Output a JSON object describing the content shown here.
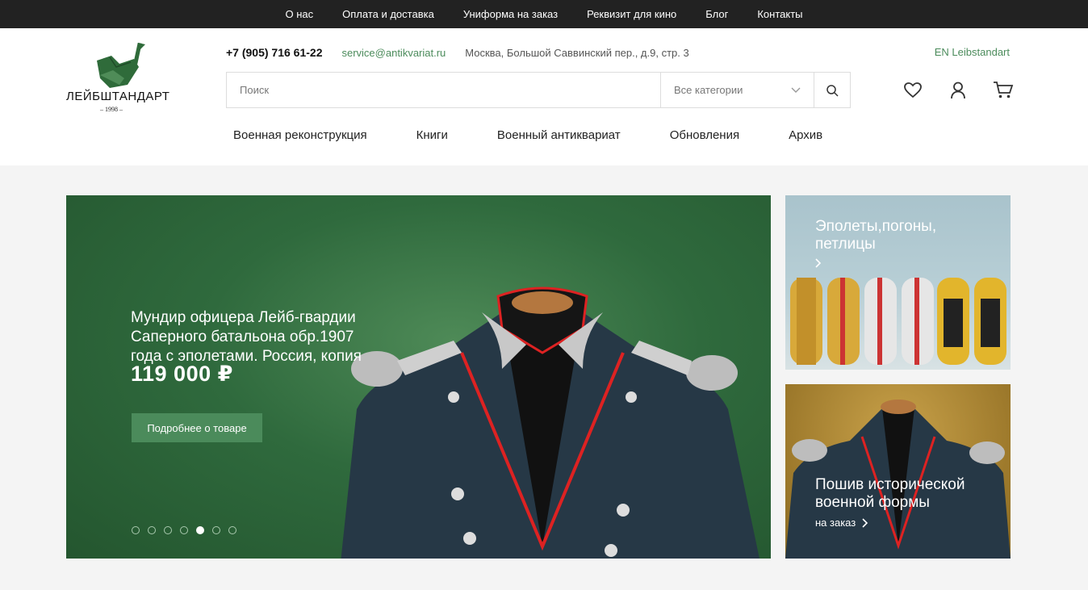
{
  "topnav": [
    "О нас",
    "Оплата и доставка",
    "Униформа на заказ",
    "Реквизит для кино",
    "Блог",
    "Контакты"
  ],
  "logo": {
    "name": "ЛЕЙБШТАНДАРТ",
    "year": "1998"
  },
  "contacts": {
    "phone": "+7 (905) 716 61-22",
    "email": "service@antikvariat.ru",
    "address": "Москва, Большой Саввинский пер., д.9, стр. 3"
  },
  "lang": "EN Leibstandart",
  "search": {
    "placeholder": "Поиск",
    "category": "Все категории"
  },
  "header_icons": [
    "heart-icon",
    "user-icon",
    "cart-icon"
  ],
  "mainnav": [
    "Военная реконструкция",
    "Книги",
    "Военный антиквариат",
    "Обновления",
    "Архив"
  ],
  "hero": {
    "title": "Мундир офицера Лейб-гвардии Саперного батальона обр.1907 года с эполетами. Россия, копия",
    "price": "119 000 ₽",
    "button": "Подробнее о товаре",
    "slides_total": 7,
    "active_slide": 5
  },
  "banners": [
    {
      "title": "Эполеты,погоны, петлицы",
      "subtitle": ""
    },
    {
      "title": "Пошив исторической военной формы",
      "subtitle": "на заказ"
    }
  ],
  "colors": {
    "accent": "#4b8b5b",
    "topbar": "#222222",
    "hero_bg": "#2f6a3d"
  }
}
